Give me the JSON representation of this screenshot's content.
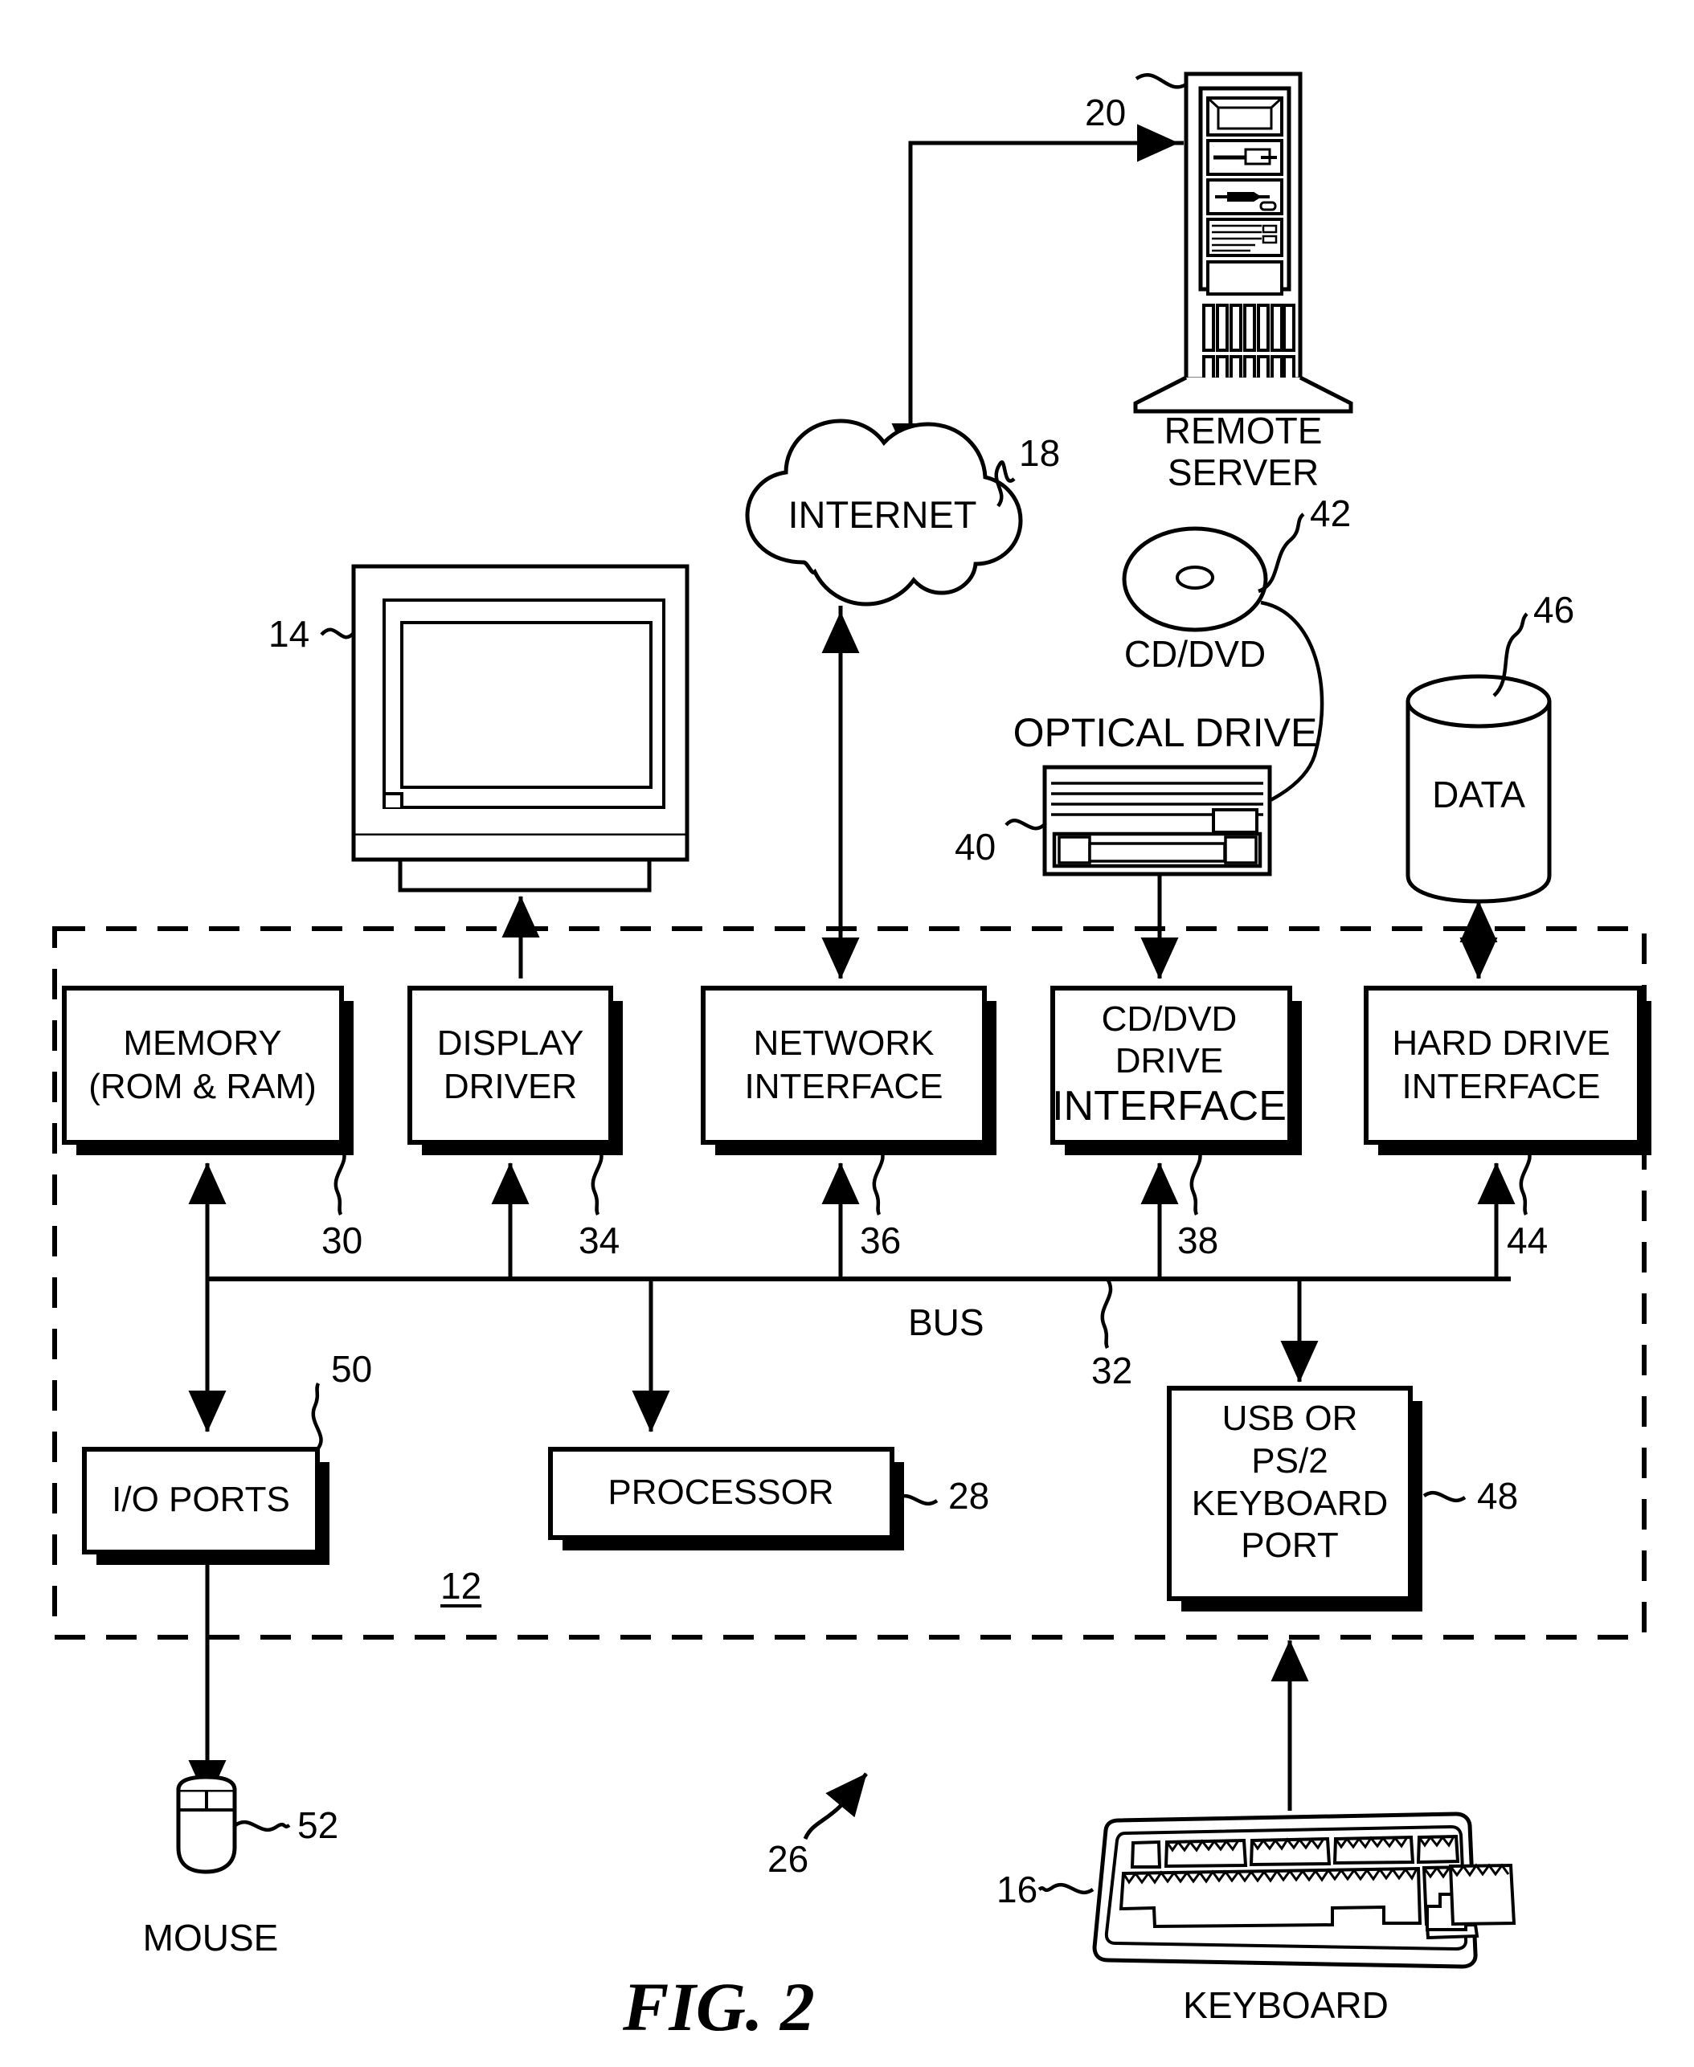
{
  "figure": {
    "caption": "FIG. 2",
    "system_ref": "12",
    "overall_ref": "26",
    "bus_label": "BUS",
    "bus_ref": "32"
  },
  "external_devices": [
    {
      "name": "remote-server",
      "label_line1": "REMOTE",
      "label_line2": "SERVER",
      "ref": "20"
    },
    {
      "name": "internet-cloud",
      "label": "INTERNET",
      "ref": "18"
    },
    {
      "name": "monitor",
      "label": "",
      "ref": "14"
    },
    {
      "name": "cd-dvd-disc",
      "label": "CD/DVD",
      "ref": "42"
    },
    {
      "name": "optical-drive",
      "label": "OPTICAL DRIVE",
      "ref": "40"
    },
    {
      "name": "data-store",
      "label": "DATA",
      "ref": "46"
    },
    {
      "name": "mouse",
      "label": "MOUSE",
      "ref": "52"
    },
    {
      "name": "keyboard",
      "label": "KEYBOARD",
      "ref": "16"
    }
  ],
  "blocks": [
    {
      "name": "memory",
      "lines": [
        "MEMORY",
        "(ROM & RAM)"
      ],
      "ref": "30"
    },
    {
      "name": "display-driver",
      "lines": [
        "DISPLAY",
        "DRIVER"
      ],
      "ref": "34"
    },
    {
      "name": "network-interface",
      "lines": [
        "NETWORK",
        "INTERFACE"
      ],
      "ref": "36"
    },
    {
      "name": "cd-dvd-interface",
      "lines": [
        "CD/DVD",
        "DRIVE",
        "INTERFACE"
      ],
      "ref": "38"
    },
    {
      "name": "hard-drive-interface",
      "lines": [
        "HARD DRIVE",
        "INTERFACE"
      ],
      "ref": "44"
    },
    {
      "name": "io-ports",
      "lines": [
        "I/O PORTS"
      ],
      "ref": "50"
    },
    {
      "name": "processor",
      "lines": [
        "PROCESSOR"
      ],
      "ref": "28"
    },
    {
      "name": "keyboard-port",
      "lines": [
        "USB OR",
        "PS/2",
        "KEYBOARD",
        "PORT"
      ],
      "ref": "48"
    }
  ],
  "colors": {
    "ink": "#000000",
    "paper": "#ffffff"
  }
}
